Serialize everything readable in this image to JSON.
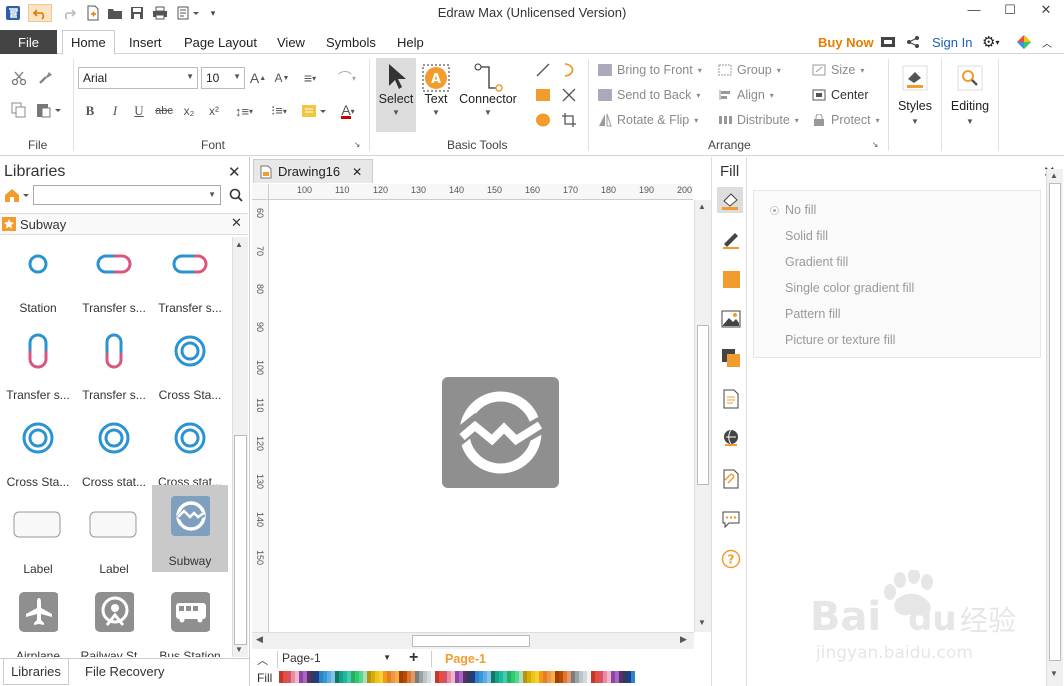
{
  "window": {
    "title": "Edraw Max (Unlicensed Version)",
    "help_glyph": "?"
  },
  "menu": {
    "file": "File",
    "tabs": [
      "Home",
      "Insert",
      "Page Layout",
      "View",
      "Symbols",
      "Help"
    ],
    "buy_now": "Buy Now",
    "sign_in": "Sign In"
  },
  "ribbon": {
    "groups": {
      "file": "File",
      "font": "Font",
      "basic_tools": "Basic Tools",
      "arrange": "Arrange",
      "styles": "Styles",
      "editing": "Editing"
    },
    "font_name": "Arial",
    "font_size": "10",
    "format_buttons": [
      "B",
      "I",
      "U",
      "abc",
      "x₂",
      "x²"
    ],
    "tools": {
      "select": "Select",
      "text": "Text",
      "connector": "Connector"
    },
    "arrange": {
      "bring_to_front": "Bring to Front",
      "send_to_back": "Send to Back",
      "rotate_flip": "Rotate & Flip",
      "group": "Group",
      "align": "Align",
      "distribute": "Distribute",
      "size": "Size",
      "center": "Center",
      "protect": "Protect"
    }
  },
  "libraries": {
    "title": "Libraries",
    "category": "Subway",
    "shapes": [
      {
        "label": "Station",
        "icon": "station-circle-icon"
      },
      {
        "label": "Transfer s...",
        "icon": "transfer-pill-h-icon"
      },
      {
        "label": "Transfer s...",
        "icon": "transfer-pill-h2-icon"
      },
      {
        "label": "Transfer s...",
        "icon": "transfer-pill-v-icon"
      },
      {
        "label": "Transfer s...",
        "icon": "transfer-pill-v2-icon"
      },
      {
        "label": "Cross Sta...",
        "icon": "cross-station-ring-icon"
      },
      {
        "label": "Cross Sta...",
        "icon": "cross-station-ring-icon"
      },
      {
        "label": "Cross stat...",
        "icon": "cross-station-ring-icon"
      },
      {
        "label": "Cross stat...",
        "icon": "cross-station-ring-icon"
      },
      {
        "label": "Label",
        "icon": "label-box-icon"
      },
      {
        "label": "Label",
        "icon": "label-box-icon"
      },
      {
        "label": "Subway",
        "icon": "subway-logo-icon"
      },
      {
        "label": "Airplane",
        "icon": "airplane-icon"
      },
      {
        "label": "Railway St...",
        "icon": "railway-station-icon"
      },
      {
        "label": "Bus Station",
        "icon": "bus-icon"
      }
    ],
    "bottom_tabs": [
      "Libraries",
      "File Recovery"
    ]
  },
  "document": {
    "tab": "Drawing16",
    "ruler_top": [
      "100",
      "110",
      "120",
      "130",
      "140",
      "150",
      "160",
      "170",
      "180",
      "190",
      "200"
    ],
    "ruler_left": [
      "60",
      "70",
      "80",
      "90",
      "100",
      "110",
      "120",
      "130",
      "140",
      "150"
    ],
    "page_select": "Page-1",
    "page_tab": "Page-1",
    "fill_label": "Fill"
  },
  "fill_panel": {
    "title": "Fill",
    "options": [
      "No fill",
      "Solid fill",
      "Gradient fill",
      "Single color gradient fill",
      "Pattern fill",
      "Picture or texture fill"
    ],
    "selected": "No fill"
  },
  "colors": {
    "accent": "#f39c2e",
    "link": "#1a5fb4",
    "subway_gray": "#8f8f8f",
    "ring_blue": "#2b93d1",
    "pill_pink": "#d9577e"
  },
  "watermark": {
    "brand": "Bai",
    "brand2": "du",
    "cn": "经验",
    "url": "jingyan.baidu.com"
  }
}
